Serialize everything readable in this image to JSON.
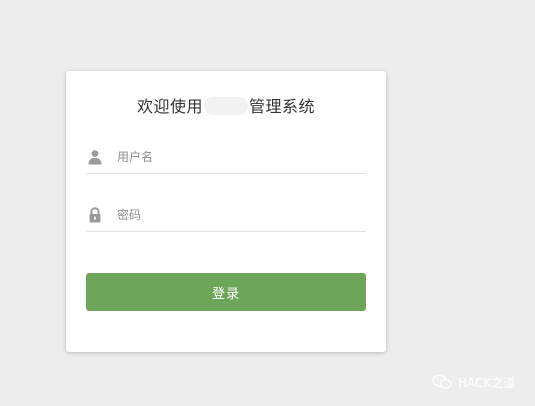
{
  "login": {
    "title_prefix": "欢迎使用",
    "title_suffix": "管理系统",
    "username_placeholder": "用户名",
    "password_placeholder": "密码",
    "submit_label": "登录"
  },
  "watermark": {
    "text": "HACK之道"
  },
  "colors": {
    "background": "#ededed",
    "card": "#ffffff",
    "button": "#6da659",
    "icon": "#9a9a9a"
  },
  "icons": {
    "username": "user-icon",
    "password": "lock-icon",
    "watermark": "wechat-icon"
  }
}
